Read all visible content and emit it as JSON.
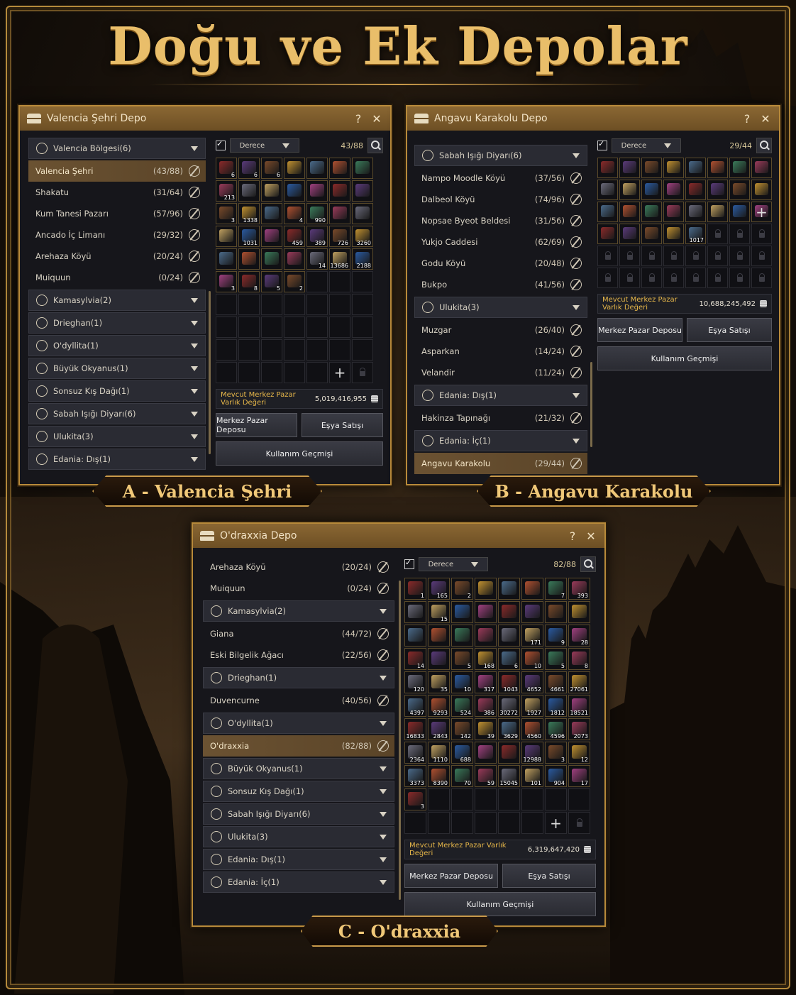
{
  "page": {
    "title": "Doğu ve Ek Depolar"
  },
  "colors": {
    "gold": "#e9be6a",
    "selected_row": "#6b5232",
    "value_label": "#e8b84a"
  },
  "common": {
    "sort_label": "Derece",
    "value_label": "Mevcut Merkez Pazar Varlık Değeri",
    "btn_market": "Merkez Pazar Deposu",
    "btn_sell": "Eşya Satışı",
    "btn_history": "Kullanım Geçmişi",
    "help": "?",
    "close": "✕"
  },
  "panels": {
    "a": {
      "window_title": "Valencia Şehri Depo",
      "banner": "A - Valencia Şehri",
      "count": "43/88",
      "value": "5,019,416,955",
      "list": [
        {
          "type": "group",
          "name": "Valencia Bölgesi(6)",
          "icon": "diamond-icon"
        },
        {
          "type": "row",
          "name": "Valencia Şehri",
          "count": "(43/88)",
          "selected": true
        },
        {
          "type": "row",
          "name": "Shakatu",
          "count": "(31/64)"
        },
        {
          "type": "row",
          "name": "Kum Tanesi Pazarı",
          "count": "(57/96)"
        },
        {
          "type": "row",
          "name": "Ancado İç Limanı",
          "count": "(29/32)"
        },
        {
          "type": "row",
          "name": "Arehaza Köyü",
          "count": "(20/24)"
        },
        {
          "type": "row",
          "name": "Muiquun",
          "count": "(0/24)"
        },
        {
          "type": "group",
          "name": "Kamasylvia(2)",
          "icon": "leaf-icon"
        },
        {
          "type": "group",
          "name": "Drieghan(1)",
          "icon": "mountain-icon"
        },
        {
          "type": "group",
          "name": "O'dyllita(1)",
          "icon": "sun-icon"
        },
        {
          "type": "group",
          "name": "Büyük Okyanus(1)",
          "icon": "globe-icon"
        },
        {
          "type": "group",
          "name": "Sonsuz Kış Dağı(1)",
          "icon": "snowflake-icon"
        },
        {
          "type": "group",
          "name": "Sabah Işığı Diyarı(6)",
          "icon": "sunrise-icon"
        },
        {
          "type": "group",
          "name": "Ulukita(3)",
          "icon": "star-icon"
        },
        {
          "type": "group",
          "name": "Edania: Dış(1)",
          "icon": "swirl-icon"
        }
      ],
      "items": [
        "6",
        "6",
        "6",
        "",
        "",
        "",
        "",
        "213",
        "",
        "",
        "",
        "",
        "",
        "",
        "3",
        "1338",
        "",
        "4",
        "990",
        "",
        "",
        "",
        "1031",
        "",
        "459",
        "389",
        "726",
        "3260",
        "",
        "",
        "",
        "",
        "14",
        "13686",
        "2188",
        "3",
        "8",
        "5",
        "2"
      ]
    },
    "b": {
      "window_title": "Angavu Karakolu Depo",
      "banner": "B - Angavu Karakolu",
      "count": "29/44",
      "value": "10,688,245,492",
      "list": [
        {
          "type": "group",
          "name": "Sabah Işığı Diyarı(6)",
          "icon": "sunrise-icon"
        },
        {
          "type": "row",
          "name": "Nampo Moodle Köyü",
          "count": "(37/56)"
        },
        {
          "type": "row",
          "name": "Dalbeol Köyü",
          "count": "(74/96)"
        },
        {
          "type": "row",
          "name": "Nopsae Byeot Beldesi",
          "count": "(31/56)"
        },
        {
          "type": "row",
          "name": "Yukjo Caddesi",
          "count": "(62/69)"
        },
        {
          "type": "row",
          "name": "Godu Köyü",
          "count": "(20/48)"
        },
        {
          "type": "row",
          "name": "Bukpo",
          "count": "(41/56)"
        },
        {
          "type": "group",
          "name": "Ulukita(3)",
          "icon": "star-icon"
        },
        {
          "type": "row",
          "name": "Muzgar",
          "count": "(26/40)"
        },
        {
          "type": "row",
          "name": "Asparkan",
          "count": "(14/24)"
        },
        {
          "type": "row",
          "name": "Velandir",
          "count": "(11/24)"
        },
        {
          "type": "group",
          "name": "Edania: Dış(1)",
          "icon": "swirl-icon"
        },
        {
          "type": "row",
          "name": "Hakinza Tapınağı",
          "count": "(21/32)"
        },
        {
          "type": "group",
          "name": "Edania: İç(1)",
          "icon": "lattice-icon"
        },
        {
          "type": "row",
          "name": "Angavu Karakolu",
          "count": "(29/44)",
          "selected": true
        }
      ],
      "items": [
        "",
        "",
        "",
        "",
        "",
        "",
        "",
        "",
        "",
        "",
        "",
        "",
        "",
        "",
        "",
        "",
        "",
        "",
        "",
        "",
        "",
        "",
        "",
        "",
        "",
        "",
        "",
        "",
        "1017"
      ]
    },
    "c": {
      "window_title": "O'draxxia Depo",
      "banner": "C - O'draxxia",
      "count": "82/88",
      "value": "6,319,647,420",
      "list": [
        {
          "type": "row",
          "name": "Arehaza Köyü",
          "count": "(20/24)"
        },
        {
          "type": "row",
          "name": "Muiquun",
          "count": "(0/24)"
        },
        {
          "type": "group",
          "name": "Kamasylvia(2)",
          "icon": "leaf-icon"
        },
        {
          "type": "row",
          "name": "Giana",
          "count": "(44/72)"
        },
        {
          "type": "row",
          "name": "Eski Bilgelik Ağacı",
          "count": "(22/56)"
        },
        {
          "type": "group",
          "name": "Drieghan(1)",
          "icon": "mountain-icon"
        },
        {
          "type": "row",
          "name": "Duvencurne",
          "count": "(40/56)"
        },
        {
          "type": "group",
          "name": "O'dyllita(1)",
          "icon": "sun-icon"
        },
        {
          "type": "row",
          "name": "O'draxxia",
          "count": "(82/88)",
          "selected": true
        },
        {
          "type": "group",
          "name": "Büyük Okyanus(1)",
          "icon": "globe-icon"
        },
        {
          "type": "group",
          "name": "Sonsuz Kış Dağı(1)",
          "icon": "snowflake-icon"
        },
        {
          "type": "group",
          "name": "Sabah Işığı Diyarı(6)",
          "icon": "sunrise-icon"
        },
        {
          "type": "group",
          "name": "Ulukita(3)",
          "icon": "star-icon"
        },
        {
          "type": "group",
          "name": "Edania: Dış(1)",
          "icon": "swirl-icon"
        },
        {
          "type": "group",
          "name": "Edania: İç(1)",
          "icon": "lattice-icon"
        }
      ],
      "items": [
        "1",
        "165",
        "2",
        "",
        "",
        "",
        "7",
        "393",
        "",
        "15",
        "",
        "",
        "",
        "",
        "",
        "",
        "",
        "",
        "",
        "",
        "",
        "171",
        "9",
        "28",
        "14",
        "",
        "5",
        "168",
        "6",
        "10",
        "5",
        "8",
        "120",
        "35",
        "10",
        "317",
        "1043",
        "4652",
        "4661",
        "27061",
        "4397",
        "9293",
        "524",
        "386",
        "30272",
        "1927",
        "1812",
        "18521",
        "16833",
        "2843",
        "142",
        "39",
        "3629",
        "4560",
        "4596",
        "2073",
        "2364",
        "1110",
        "688",
        "",
        "",
        "12988",
        "3",
        "12",
        "3373",
        "8390",
        "70",
        "59",
        "15045",
        "101",
        "904",
        "17",
        "3"
      ]
    }
  }
}
